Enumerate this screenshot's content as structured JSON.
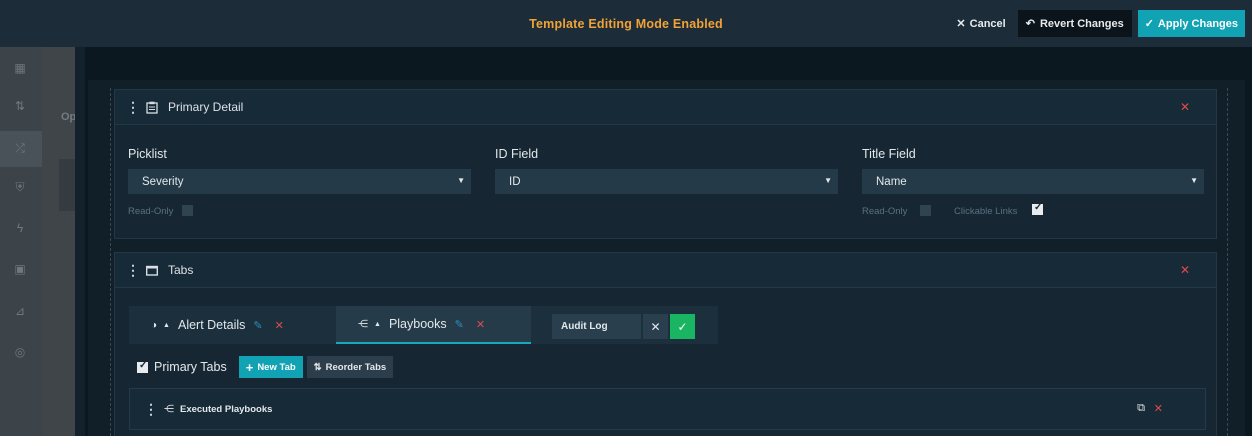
{
  "topbar": {
    "mode_title": "Template Editing Mode Enabled",
    "cancel_label": "Cancel",
    "revert_label": "Revert Changes",
    "apply_label": "Apply Changes"
  },
  "sidebar": {
    "items": [
      "grid-icon",
      "sort-icon",
      "shuffle-icon",
      "shield-icon",
      "bolt-icon",
      "briefcase-icon",
      "chart-icon",
      "globe-icon"
    ],
    "active_index": 2,
    "background_label": "Op"
  },
  "primary_detail": {
    "title": "Primary Detail",
    "fields": [
      {
        "label": "Picklist",
        "value": "Severity",
        "read_only_label": "Read-Only",
        "read_only": false
      },
      {
        "label": "ID Field",
        "value": "ID"
      },
      {
        "label": "Title Field",
        "value": "Name",
        "read_only_label": "Read-Only",
        "read_only": false,
        "clickable_links_label": "Clickable Links",
        "clickable_links": true
      }
    ]
  },
  "tabs_section": {
    "title": "Tabs",
    "tabs": [
      {
        "label": "Alert Details",
        "icon": "toggle-icon",
        "active": false
      },
      {
        "label": "Playbooks",
        "icon": "playbook-icon",
        "active": true
      }
    ],
    "new_tab_input_value": "Audit Log",
    "primary_tabs_label": "Primary Tabs",
    "primary_tabs_checked": true,
    "new_tab_button": "New Tab",
    "reorder_tabs_button": "Reorder Tabs",
    "widget": {
      "title": "Executed Playbooks"
    }
  },
  "colors": {
    "accent": "#11a3b3",
    "warning_title": "#f2a336",
    "danger": "#e24a4a",
    "success": "#19b562"
  }
}
